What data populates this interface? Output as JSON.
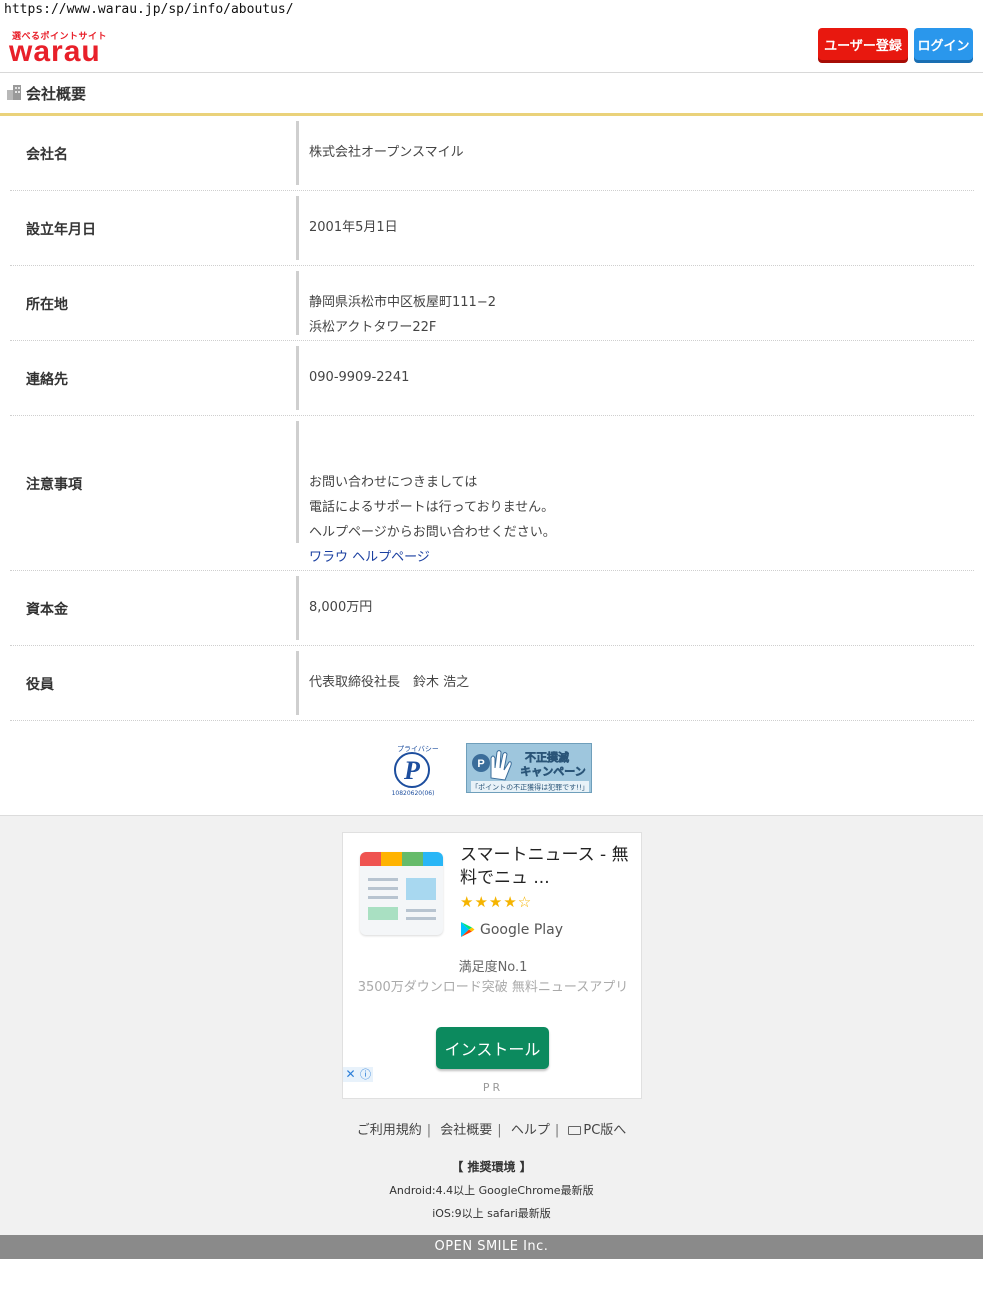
{
  "browser": {
    "url": "https://www.warau.jp/sp/info/aboutus/"
  },
  "header": {
    "logo_tagline": "選べるポイントサイト",
    "logo_word": "warau",
    "register_label": "ユーザー登録",
    "login_label": "ログイン"
  },
  "section": {
    "title": "会社概要"
  },
  "company": {
    "rows": [
      {
        "label": "会社名",
        "lines": [
          "株式会社オープンスマイル"
        ]
      },
      {
        "label": "設立年月日",
        "lines": [
          "2001年5月1日"
        ]
      },
      {
        "label": "所在地",
        "lines": [
          "静岡県浜松市中区板屋町111−2",
          "浜松アクトタワー22F"
        ]
      },
      {
        "label": "連絡先",
        "lines": [
          "090-9909-2241"
        ]
      },
      {
        "label": "注意事項",
        "lines": [
          "お問い合わせにつきましては",
          "電話によるサポートは行っておりません。",
          "ヘルプページからお問い合わせください。"
        ],
        "link": "ワラウ ヘルプページ"
      },
      {
        "label": "資本金",
        "lines": [
          "8,000万円"
        ]
      },
      {
        "label": "役員",
        "lines": [
          "代表取締役社長　鈴木 浩之"
        ]
      }
    ]
  },
  "badges": {
    "privacy_mark": {
      "top_text": "プライバシー",
      "number": "10820620(06)"
    },
    "campaign": {
      "title": "不正撲滅キャンペーン",
      "sub": "「ポイントの不正獲得は犯罪です!!」"
    }
  },
  "ad": {
    "title": "スマートニュース - 無料でニュ ...",
    "stars": "★★★★☆",
    "rating": 4,
    "store": "Google Play",
    "subtitle": "満足度No.1",
    "description": "3500万ダウンロード突破 無料ニュースアプリ",
    "install_label": "インストール",
    "close_glyph": "✕",
    "info_glyph": "ⓘ",
    "pr_label": "PR",
    "colors": {
      "install": "#0c8a5e",
      "stars": "#f5b400"
    }
  },
  "footer": {
    "links": [
      "ご利用規約",
      "会社概要",
      "ヘルプ",
      "PC版へ"
    ],
    "recommended_title": "【 推奨環境 】",
    "recommended_android": "Android:4.4以上 GoogleChrome最新版",
    "recommended_ios": "iOS:9以上 safari最新版",
    "copyright": "OPEN SMILE Inc."
  },
  "colors": {
    "brand_red": "#e8202a",
    "register_btn": "#e8180f",
    "login_btn": "#2a97ec",
    "accent_line": "#ead27a"
  }
}
